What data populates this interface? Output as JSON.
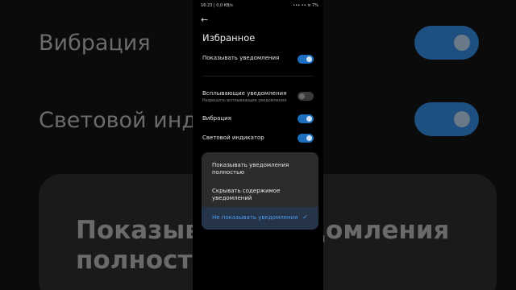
{
  "background": {
    "row1": "Вибрация",
    "row2": "Световой индикатор",
    "panel_line1": "Показывать уведомления",
    "panel_line2": "полностью"
  },
  "status_bar": {
    "time": "16:23 | 0,0 KB/s",
    "right": "••• •• ≡ 7%"
  },
  "header": {
    "back_icon": "←",
    "title": "Избранное"
  },
  "settings": [
    {
      "label": "Показывать уведомления",
      "toggle": "on"
    },
    {
      "label": "Всплывающие уведомления",
      "sublabel": "Разрешить всплывающие уведомления",
      "toggle": "off"
    },
    {
      "label": "Вибрация",
      "toggle": "on"
    },
    {
      "label": "Световой индикатор",
      "toggle": "on"
    }
  ],
  "menu": {
    "options": [
      {
        "line1": "Показывать уведомления",
        "line2": "полностью",
        "selected": false
      },
      {
        "line1": "Скрывать содержимое",
        "line2": "уведомлений",
        "selected": false
      },
      {
        "line1": "Не показывать уведомления",
        "line2": "",
        "selected": true
      }
    ],
    "check_icon": "✓"
  },
  "colors": {
    "accent": "#1e6fbf",
    "selected_text": "#4d9df0",
    "menu_bg": "#2c2c2e"
  }
}
